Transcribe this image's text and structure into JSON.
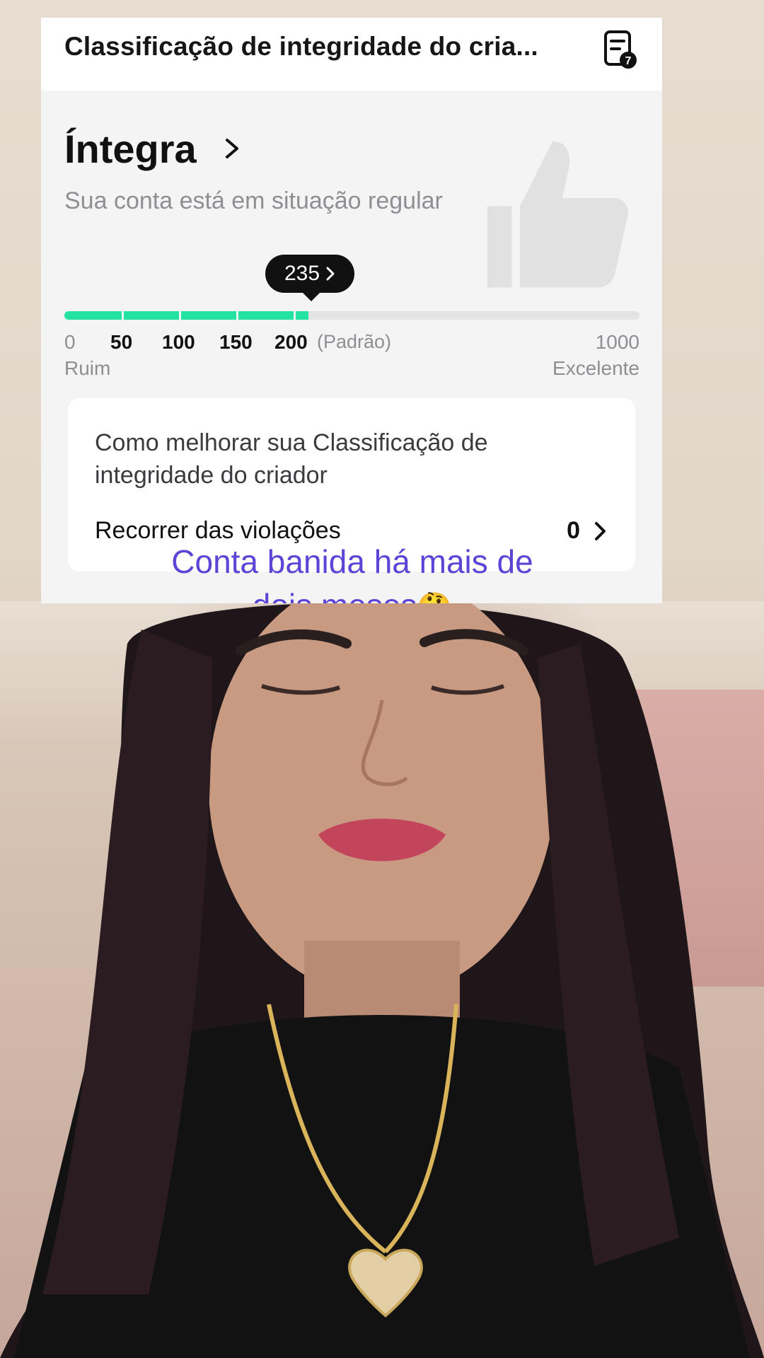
{
  "header": {
    "title": "Classificação de integridade do cria...",
    "doc_badge": "7"
  },
  "status": {
    "title": "Íntegra",
    "subtitle": "Sua conta está em situação regular"
  },
  "score": {
    "value_label": "235",
    "value": 235,
    "max": 1000
  },
  "scale": {
    "ticks": [
      "0",
      "50",
      "100",
      "150",
      "200"
    ],
    "default_note": "(Padrão)",
    "max_label": "1000",
    "low_label": "Ruim",
    "high_label": "Excelente"
  },
  "tips": {
    "title": "Como melhorar sua Classificação de integridade do criador",
    "row_label": "Recorrer das violações",
    "row_count": "0"
  },
  "caption": {
    "line1": "Conta banida há mais de",
    "line2": "dois meses",
    "emoji": "🤔"
  },
  "colors": {
    "accent": "#24e3a1",
    "caption": "#5b45d6"
  }
}
